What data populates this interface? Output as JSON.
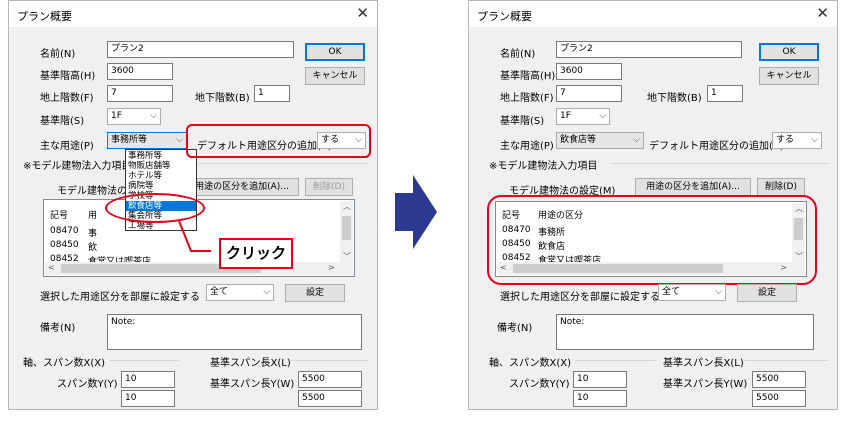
{
  "left_dialog": {
    "title": "プラン概要",
    "labels": {
      "name": "名前(N)",
      "base_height": "基準階高(H)",
      "floors_above": "地上階数(F)",
      "floors_below": "地下階数(B)",
      "base_floor": "基準階(S)",
      "main_use": "主な用途(P)",
      "default_use": "デフォルト用途区分の追加(A)",
      "model_section": "※モデル建物法入力項目",
      "model_settings": "モデル建物法の",
      "select_label": "選択した用途区分を部屋に設定する",
      "memo": "備考(N)",
      "axis_span": "軸、スパン数X(X)",
      "span_y": "スパン数Y(Y)",
      "base_span_x": "基準スパン長X(L)",
      "base_span_y": "基準スパン長Y(W)"
    },
    "values": {
      "name": "プラン2",
      "base_height": "3600",
      "floors_above": "7",
      "floors_below": "1",
      "base_floor": "1F",
      "main_use": "事務所等",
      "default_use": "する",
      "select": "全て",
      "memo": "Note:",
      "span_x": "10",
      "span_y": "10",
      "base_span_x": "5500",
      "base_span_y": "5500"
    },
    "buttons": {
      "ok": "OK",
      "cancel": "キャンセル",
      "add_usage": "用途の区分を追加(A)...",
      "delete": "削除(D)",
      "set": "設定"
    },
    "list_header": {
      "code": "記号",
      "usage": "用"
    },
    "list_rows": [
      {
        "code": "08470",
        "usage": "事"
      },
      {
        "code": "08450",
        "usage": "飲"
      },
      {
        "code": "08452",
        "usage": "食堂又は喫茶店"
      }
    ],
    "dropdown_options": [
      "事務所等",
      "物販店舗等",
      "ホテル等",
      "病院等",
      "学校等",
      "飲食店等",
      "集会所等",
      "工場等"
    ],
    "selected_option": "飲食店等",
    "callout": "クリック"
  },
  "right_dialog": {
    "title": "プラン概要",
    "labels": {
      "name": "名前(N)",
      "base_height": "基準階高(H)",
      "floors_above": "地上階数(F)",
      "floors_below": "地下階数(B)",
      "base_floor": "基準階(S)",
      "main_use": "主な用途(P)",
      "default_use": "デフォルト用途区分の追加(A)",
      "model_section": "※モデル建物法入力項目",
      "model_settings": "モデル建物法の設定(M)",
      "select_label": "選択した用途区分を部屋に設定する",
      "memo": "備考(N)",
      "axis_span": "軸、スパン数X(X)",
      "span_y": "スパン数Y(Y)",
      "base_span_x": "基準スパン長X(L)",
      "base_span_y": "基準スパン長Y(W)"
    },
    "values": {
      "name": "プラン2",
      "base_height": "3600",
      "floors_above": "7",
      "floors_below": "1",
      "base_floor": "1F",
      "main_use": "飲食店等",
      "default_use": "する",
      "select": "全て",
      "memo": "Note:",
      "span_x": "10",
      "span_y": "10",
      "base_span_x": "5500",
      "base_span_y": "5500"
    },
    "buttons": {
      "ok": "OK",
      "cancel": "キャンセル",
      "add_usage": "用途の区分を追加(A)...",
      "delete": "削除(D)",
      "set": "設定"
    },
    "list_header": {
      "code": "記号",
      "usage": "用途の区分"
    },
    "list_rows": [
      {
        "code": "08470",
        "usage": "事務所"
      },
      {
        "code": "08450",
        "usage": "飲食店"
      },
      {
        "code": "08452",
        "usage": "食堂又は喫茶店"
      }
    ]
  },
  "colors": {
    "highlight": "#e6001a",
    "arrow": "#2b3990",
    "selection": "#0078d7"
  }
}
